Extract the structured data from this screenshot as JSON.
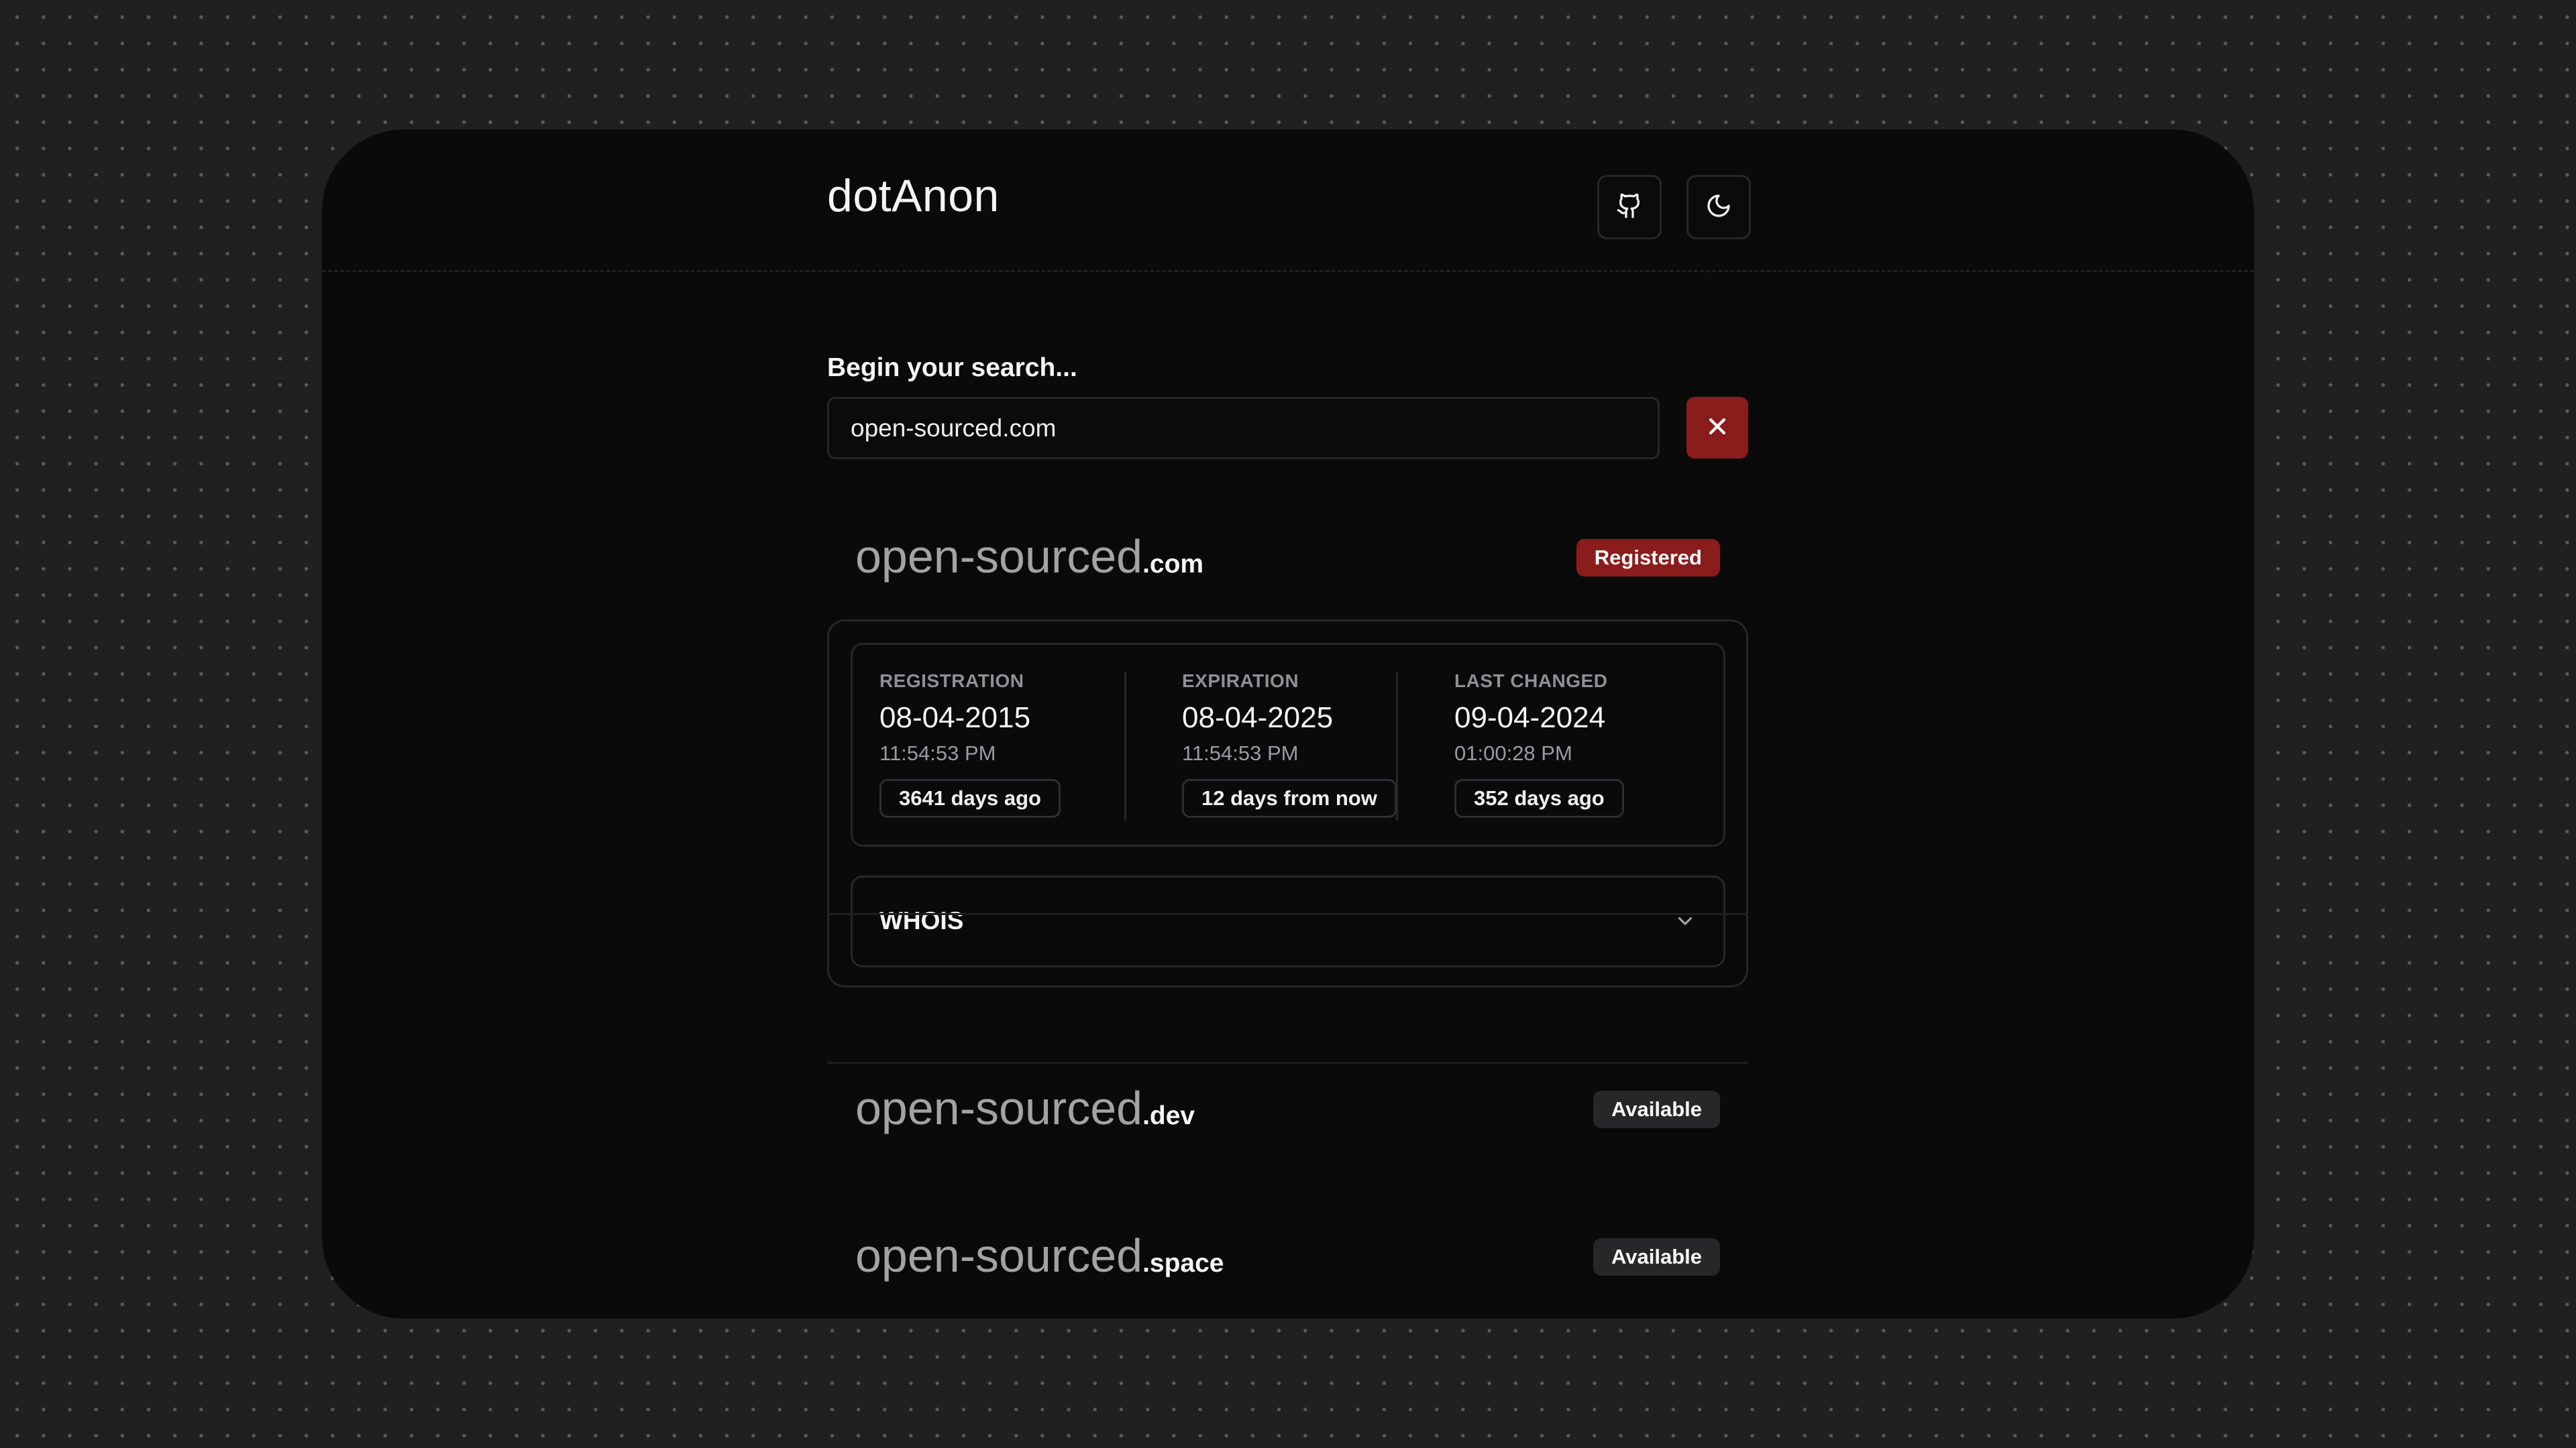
{
  "app": {
    "title": "dotAnon"
  },
  "header": {
    "github_icon": "github-icon",
    "theme_icon": "moon-icon"
  },
  "search": {
    "label": "Begin your search...",
    "value": "open-sourced.com",
    "clear_icon": "close-icon"
  },
  "results": [
    {
      "name": "open-sourced",
      "tld": ".com",
      "status": "Registered",
      "dates": {
        "registration": {
          "label": "REGISTRATION",
          "date": "08-04-2015",
          "time": "11:54:53 PM",
          "relative": "3641 days ago"
        },
        "expiration": {
          "label": "EXPIRATION",
          "date": "08-04-2025",
          "time": "11:54:53 PM",
          "relative": "12 days from now"
        },
        "last_changed": {
          "label": "LAST CHANGED",
          "date": "09-04-2024",
          "time": "01:00:28 PM",
          "relative": "352 days ago"
        }
      },
      "whois_label": "WHOIS"
    },
    {
      "name": "open-sourced",
      "tld": ".dev",
      "status": "Available"
    },
    {
      "name": "open-sourced",
      "tld": ".space",
      "status": "Available"
    }
  ],
  "colors": {
    "accent_red": "#8b1c1c",
    "badge_neutral": "#27272a",
    "background": "#0a0a0b"
  }
}
